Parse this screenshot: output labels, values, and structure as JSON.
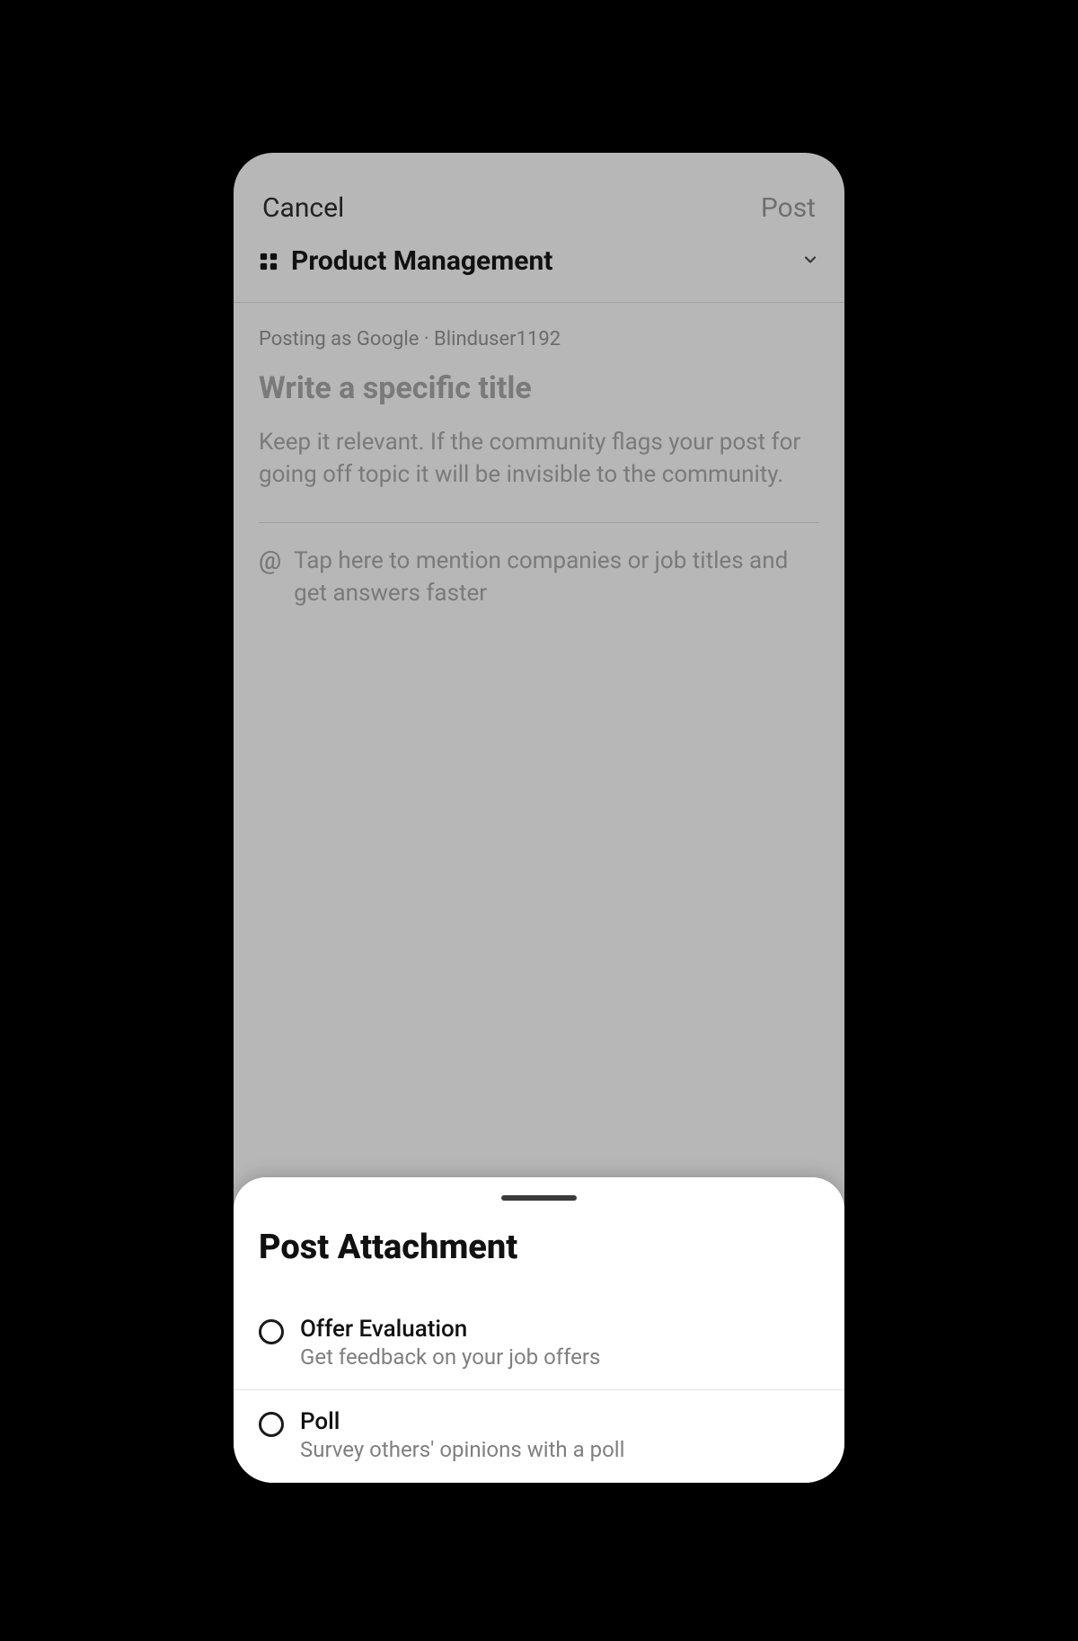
{
  "topbar": {
    "cancel": "Cancel",
    "post": "Post"
  },
  "channel": {
    "name": "Product Management"
  },
  "composer": {
    "posting_as": "Posting as Google · Blinduser1192",
    "title_placeholder": "Write a specific title",
    "body_placeholder": "Keep it relevant. If the community flags your post for going off topic it will be invisible to the community.",
    "mention_hint": "Tap here to mention companies or job titles and get answers faster"
  },
  "sheet": {
    "title": "Post Attachment",
    "options": [
      {
        "title": "Offer Evaluation",
        "subtitle": "Get feedback on your job offers"
      },
      {
        "title": "Poll",
        "subtitle": "Survey others' opinions with a poll"
      }
    ]
  }
}
